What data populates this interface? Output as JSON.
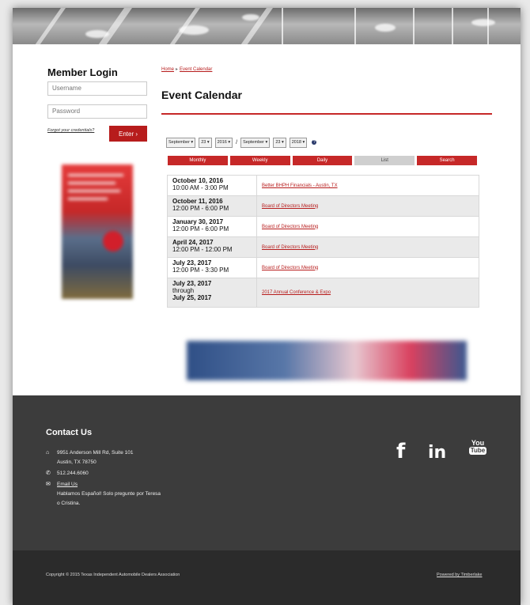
{
  "sidebar": {
    "login_title": "Member Login",
    "username_placeholder": "Username",
    "password_placeholder": "Password",
    "forgot_link": "Forgot your credentials?",
    "enter_button": "Enter  ›"
  },
  "breadcrumb": {
    "home": "Home",
    "separator": "▸",
    "current": "Event Calendar"
  },
  "main": {
    "title": "Event Calendar",
    "filters": {
      "from_month": "September ▾",
      "from_day": "23 ▾",
      "from_year": "2016 ▾",
      "slash": "/",
      "to_month": "September ▾",
      "to_day": "23 ▾",
      "to_year": "2018 ▾",
      "help": "?"
    },
    "tabs": [
      "Monthly",
      "Weekly",
      "Daily",
      "List",
      "Search"
    ],
    "events": [
      {
        "date": "October 10, 2016",
        "time": "10:00 AM - 3:00 PM",
        "title": "Better BHPH Financials - Austin, TX"
      },
      {
        "date": "October 11, 2016",
        "time": "12:00 PM - 6:00 PM",
        "title": "Board of Directors Meeting"
      },
      {
        "date": "January 30, 2017",
        "time": "12:00 PM - 6:00 PM",
        "title": "Board of Directors Meeting"
      },
      {
        "date": "April 24, 2017",
        "time": "12:00 PM - 12:00 PM",
        "title": "Board of Directors Meeting"
      },
      {
        "date": "July 23, 2017",
        "time": "12:00 PM - 3:30 PM",
        "title": "Board of Directors Meeting"
      },
      {
        "date": "July 23, 2017",
        "time": "through",
        "date_end": "July 25, 2017",
        "title": "2017 Annual Conference & Expo"
      }
    ]
  },
  "footer": {
    "contact_title": "Contact Us",
    "address_line1": "9951 Anderson Mill Rd, Suite 101",
    "address_line2": "Austin, TX 78750",
    "phone": "512.244.6060",
    "email_link": "Email Us",
    "spanish_line1": "Hablamos Español! Solo pregunte por Teresa",
    "spanish_line2": "o Cristina.",
    "social": {
      "facebook": "f",
      "linkedin": "in",
      "youtube_top": "You",
      "youtube_bottom": "Tube"
    },
    "copyright": "Copyright © 2015 Texas Independent Automobile Dealers Association",
    "powered_by": "Powered by Timberlake"
  },
  "colors": {
    "accent": "#c62828",
    "footer_bg": "#3c3c3c",
    "bottom_bg": "#2b2b2b"
  },
  "icons": {
    "address": "home-icon",
    "phone": "phone-icon",
    "email": "mail-icon"
  }
}
